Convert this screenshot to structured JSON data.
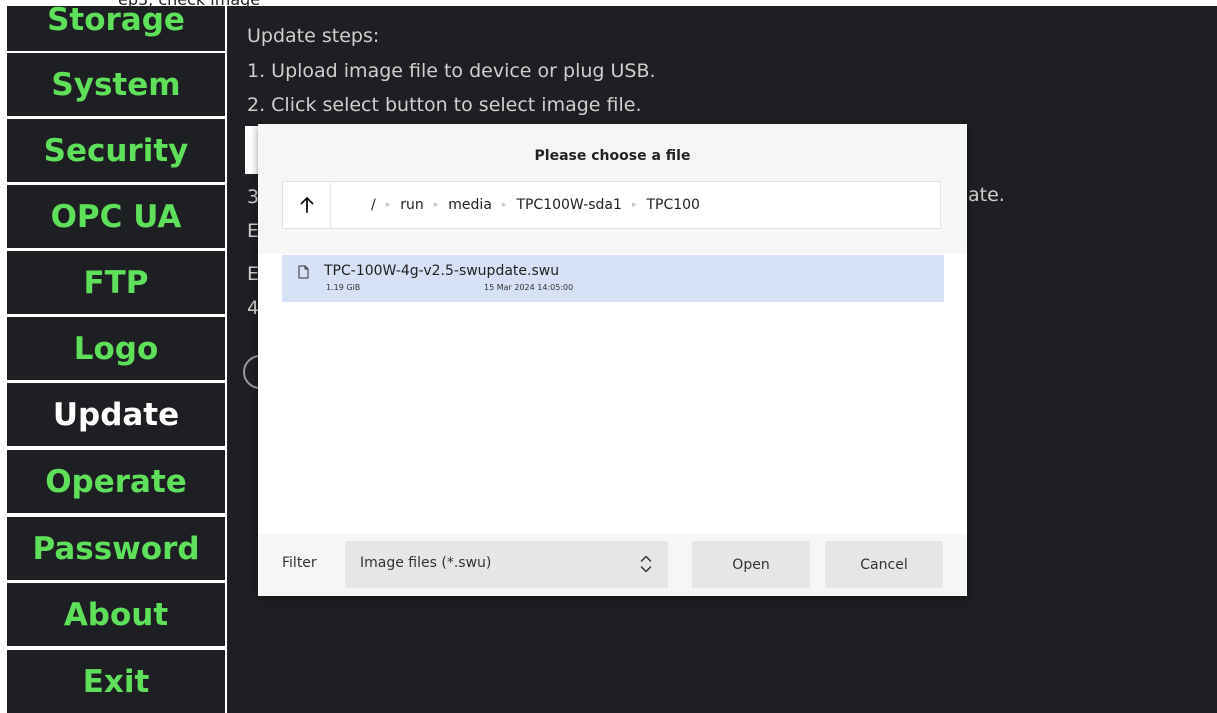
{
  "top_fragment": "ep3, check image",
  "sidebar": {
    "items": [
      {
        "label": "Storage"
      },
      {
        "label": "System"
      },
      {
        "label": "Security"
      },
      {
        "label": "OPC UA"
      },
      {
        "label": "FTP"
      },
      {
        "label": "Logo"
      },
      {
        "label": "Update",
        "active": true
      },
      {
        "label": "Operate"
      },
      {
        "label": "Password"
      },
      {
        "label": "About"
      },
      {
        "label": "Exit"
      }
    ],
    "label_color": "#5fe05a",
    "active_color": "#ffffff"
  },
  "main": {
    "steps_title": "Update steps:",
    "step1": "1. Upload image file to device or plug USB.",
    "step2": "2. Click select button to select image file.",
    "frag_3": "3",
    "frag_ate": "ate.",
    "frag_e1": "E",
    "frag_e2": "E",
    "frag_4": "4"
  },
  "dialog": {
    "title": "Please choose a file",
    "up_icon": "arrow-up-icon",
    "path": [
      "/",
      "run",
      "media",
      "TPC100W-sda1",
      "TPC100"
    ],
    "files": [
      {
        "icon": "file-icon",
        "name": "TPC-100W-4g-v2.5-swupdate.swu",
        "size": "1.19 GiB",
        "modified": "15 Mar 2024 14:05:00",
        "selected": true
      }
    ],
    "filter_label": "Filter",
    "filter_value": "Image files (*.swu)",
    "open_label": "Open",
    "cancel_label": "Cancel",
    "selection_color": "#d6e1f5"
  }
}
